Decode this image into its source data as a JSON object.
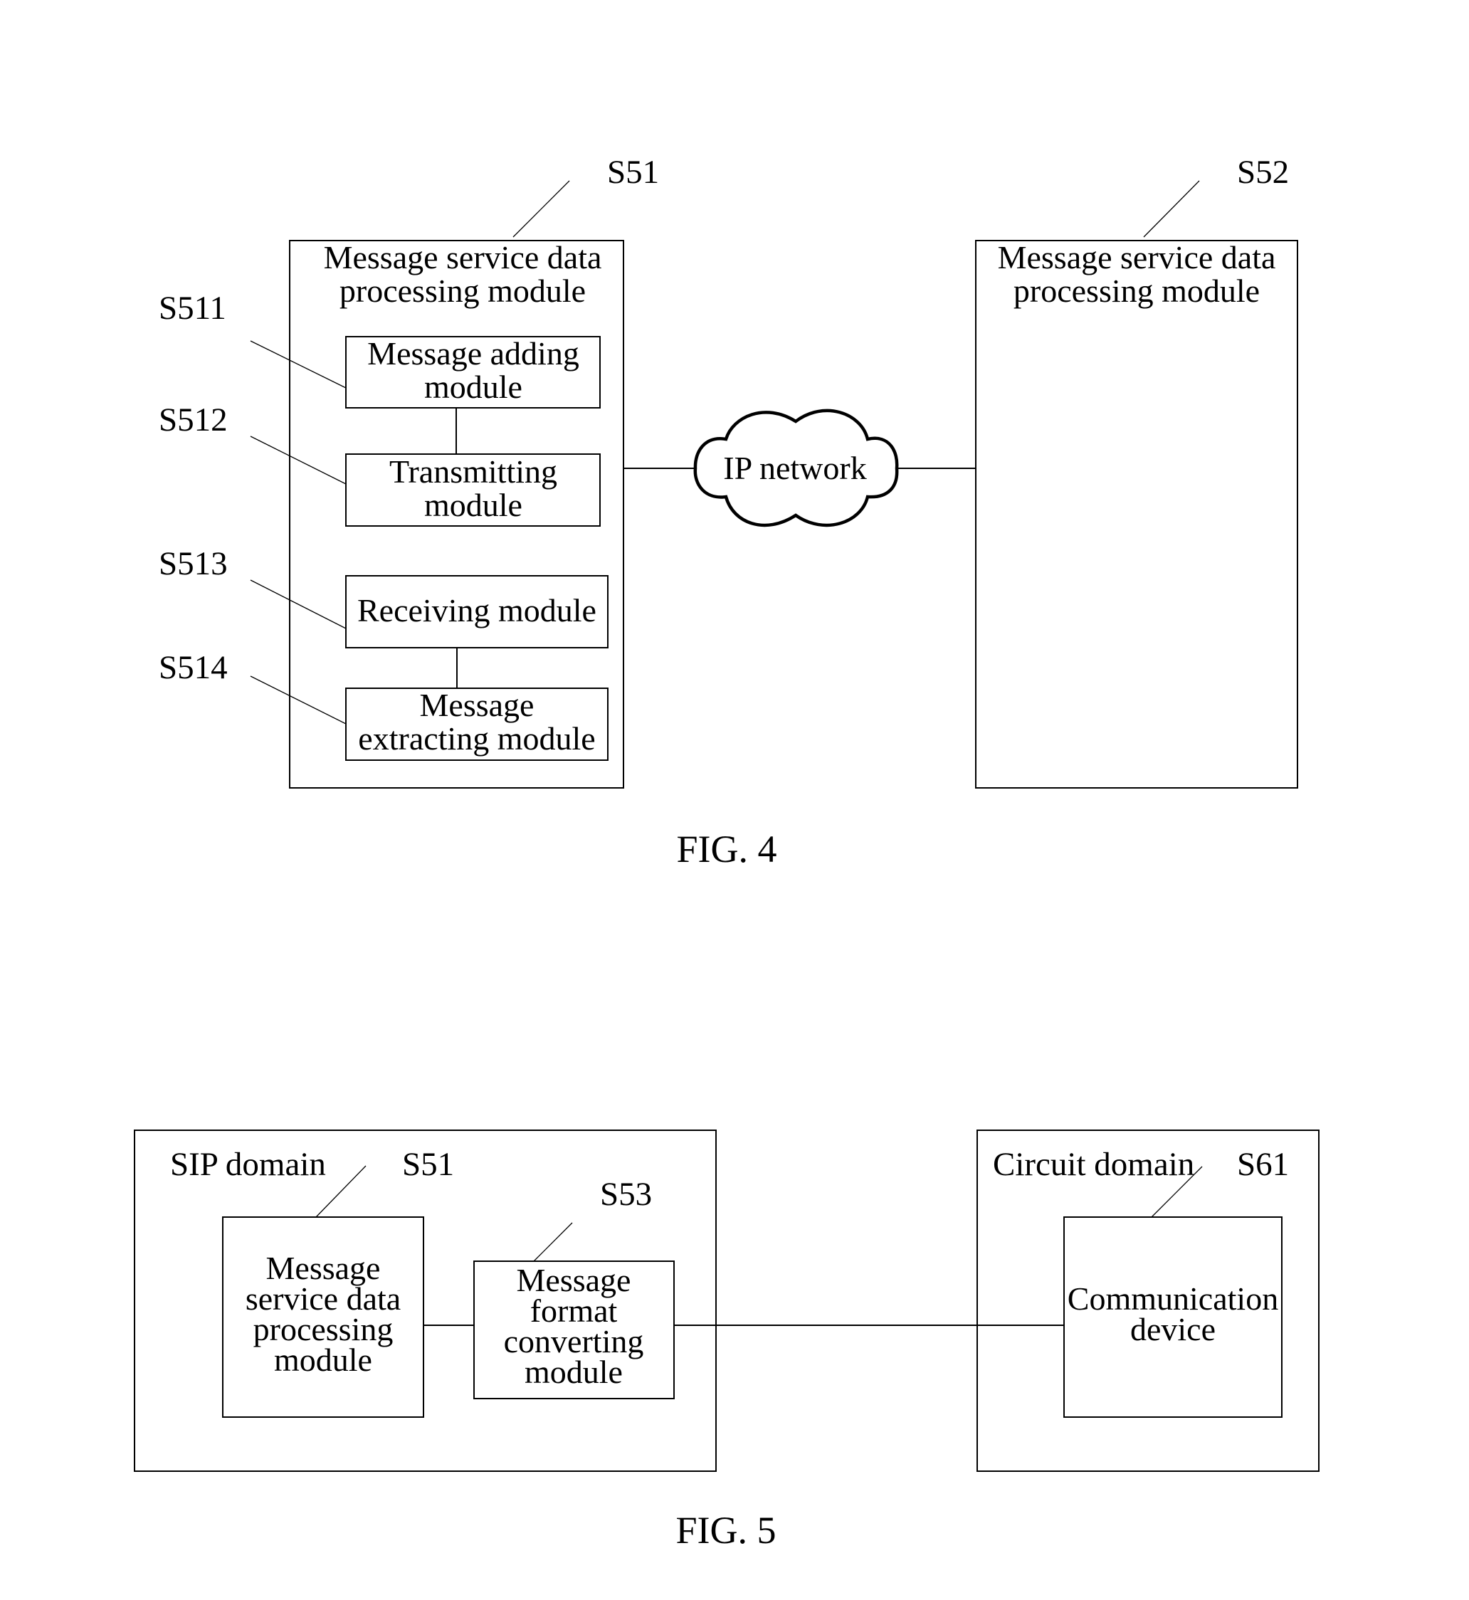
{
  "fig4": {
    "caption": "FIG. 4",
    "left_module": {
      "ref": "S51",
      "title_lines": [
        "Message service data",
        "processing module"
      ],
      "submodules": [
        {
          "ref": "S511",
          "lines": [
            "Message adding",
            "module"
          ]
        },
        {
          "ref": "S512",
          "lines": [
            "Transmitting",
            "module"
          ]
        },
        {
          "ref": "S513",
          "lines": [
            "Receiving module"
          ]
        },
        {
          "ref": "S514",
          "lines": [
            "Message",
            "extracting module"
          ]
        }
      ]
    },
    "network": {
      "label": "IP network",
      "icon": "cloud-icon"
    },
    "right_module": {
      "ref": "S52",
      "title_lines": [
        "Message service data",
        "processing module"
      ]
    }
  },
  "fig5": {
    "caption": "FIG. 5",
    "sip_domain": {
      "label": "SIP domain",
      "processing_module": {
        "ref": "S51",
        "lines": [
          "Message",
          "service data",
          "processing",
          "module"
        ]
      },
      "converter_module": {
        "ref": "S53",
        "lines": [
          "Message",
          "format",
          "converting",
          "module"
        ]
      }
    },
    "circuit_domain": {
      "label": "Circuit domain",
      "device": {
        "ref": "S61",
        "lines": [
          "Communication",
          "device"
        ]
      }
    }
  }
}
